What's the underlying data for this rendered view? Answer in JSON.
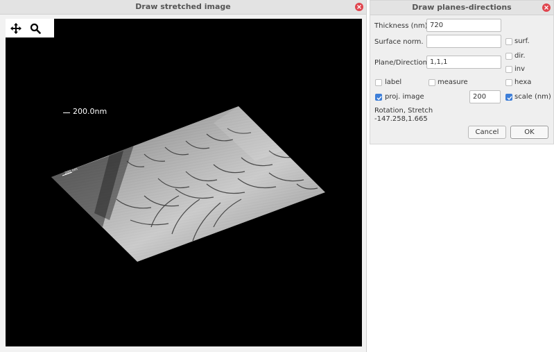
{
  "left_window": {
    "title": "Draw stretched image",
    "tools": [
      "move-icon",
      "zoom-icon"
    ],
    "scale_label": "200.0nm",
    "embedded_scale_label": "200 nm"
  },
  "right_window": {
    "title": "Draw planes-directions",
    "thickness": {
      "label": "Thickness (nm)",
      "value": "720"
    },
    "surface_norm": {
      "label": "Surface norm.",
      "value": ""
    },
    "plane_direction": {
      "label": "Plane/Direction",
      "value": "1,1,1"
    },
    "checkboxes": {
      "surf": {
        "label": "surf.",
        "checked": false
      },
      "dir": {
        "label": "dir.",
        "checked": false
      },
      "inv": {
        "label": "inv",
        "checked": false
      },
      "label": {
        "label": "label",
        "checked": false
      },
      "measure": {
        "label": "measure",
        "checked": false
      },
      "hexa": {
        "label": "hexa",
        "checked": false
      },
      "proj_image": {
        "label": "proj. image",
        "checked": true
      },
      "scale_nm": {
        "label": "scale (nm)",
        "checked": true
      }
    },
    "scale_value": "200",
    "rotation_label": "Rotation, Stretch",
    "rotation_value": "-147.258,1.665",
    "cancel_label": "Cancel",
    "ok_label": "OK"
  },
  "colors": {
    "close": "#e0454e",
    "check": "#3d7ed8",
    "canvas": "#000000"
  }
}
